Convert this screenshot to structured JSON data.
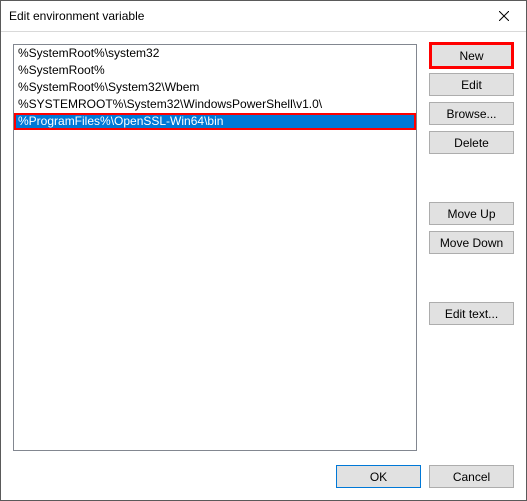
{
  "title": "Edit environment variable",
  "paths": [
    "%SystemRoot%\\system32",
    "%SystemRoot%",
    "%SystemRoot%\\System32\\Wbem",
    "%SYSTEMROOT%\\System32\\WindowsPowerShell\\v1.0\\",
    "%ProgramFiles%\\OpenSSL-Win64\\bin"
  ],
  "selected_index": 4,
  "sidebar": {
    "new": "New",
    "edit": "Edit",
    "browse": "Browse...",
    "delete": "Delete",
    "move_up": "Move Up",
    "move_down": "Move Down",
    "edit_text": "Edit text..."
  },
  "footer": {
    "ok": "OK",
    "cancel": "Cancel"
  },
  "highlight": {
    "new_button": true,
    "selected_path": true
  }
}
